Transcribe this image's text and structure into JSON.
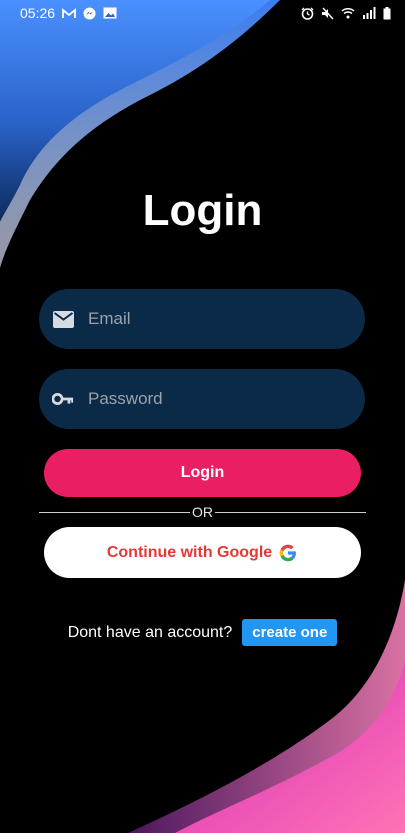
{
  "status_bar": {
    "time": "05:26",
    "left_icons": [
      "gmail-icon",
      "messenger-icon",
      "gallery-icon"
    ],
    "right_icons": [
      "alarm-icon",
      "mute-icon",
      "wifi-icon",
      "signal-icon",
      "battery-icon"
    ]
  },
  "page": {
    "title": "Login"
  },
  "form": {
    "email": {
      "placeholder": "Email",
      "icon": "email-icon"
    },
    "password": {
      "placeholder": "Password",
      "icon": "key-icon"
    },
    "login_label": "Login",
    "or_label": "OR",
    "google_label": "Continue with Google",
    "google_icon": "google-icon"
  },
  "signup": {
    "prompt": "Dont have an account?",
    "button_label": "create one"
  },
  "colors": {
    "background": "#000000",
    "top_gradient_start": "#3d8bff",
    "top_gradient_end": "#123a7a",
    "bottom_gradient_start": "#ff5fa8",
    "bottom_gradient_end": "#c62bd0",
    "field_bg": "#0b2a47",
    "login_button": "#e91e63",
    "google_text": "#e53935",
    "create_button": "#2196f3"
  }
}
